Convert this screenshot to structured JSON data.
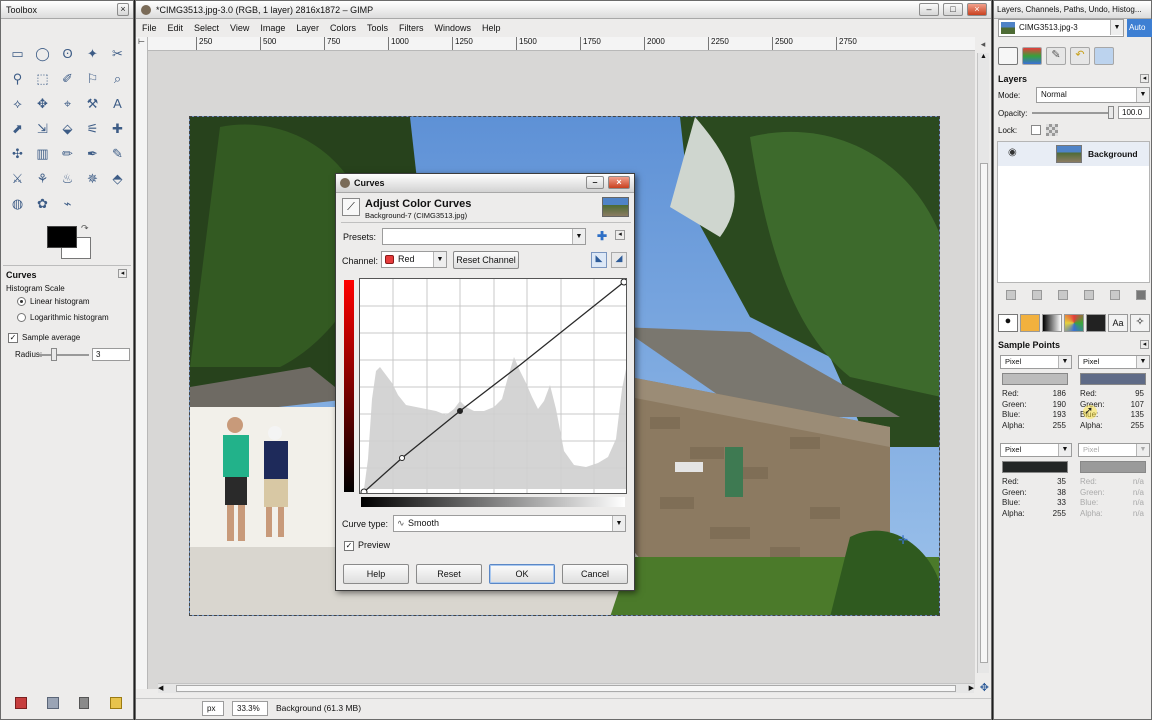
{
  "colors": {
    "accent_red": "#c80000",
    "desktop": "#1f1f1f",
    "panel": "#edeceb"
  },
  "toolbox": {
    "title": "Toolbox",
    "tool_options_title": "Curves",
    "histogram_scale_label": "Histogram Scale",
    "linear_label": "Linear histogram",
    "log_label": "Logarithmic histogram",
    "sample_average_label": "Sample average",
    "radius_label": "Radius:",
    "radius_value": "3"
  },
  "main": {
    "title": "*CIMG3513.jpg-3.0 (RGB, 1 layer) 2816x1872 – GIMP",
    "menu": [
      "File",
      "Edit",
      "Select",
      "View",
      "Image",
      "Layer",
      "Colors",
      "Tools",
      "Filters",
      "Windows",
      "Help"
    ],
    "ruler_ticks": [
      "250",
      "500",
      "750",
      "1000",
      "1250",
      "1500",
      "1750",
      "2000",
      "2250",
      "2500",
      "2750"
    ],
    "status_unit": "px",
    "status_zoom": "33.3%",
    "status_text": "Background (61.3 MB)"
  },
  "dialog": {
    "title": "Curves",
    "heading": "Adjust Color Curves",
    "subheading": "Background-7 (CIMG3513.jpg)",
    "presets_label": "Presets:",
    "presets_value": "",
    "channel_label": "Channel:",
    "channel_value": "Red",
    "reset_channel_label": "Reset Channel",
    "curve_type_label": "Curve type:",
    "curve_type_value": "Smooth",
    "preview_label": "Preview",
    "help_label": "Help",
    "reset_label": "Reset",
    "ok_label": "OK",
    "cancel_label": "Cancel"
  },
  "dock": {
    "title": "Layers, Channels, Paths, Undo, Histog...",
    "image_selector": "CIMG3513.jpg-3",
    "auto_label": "Auto",
    "layers_title": "Layers",
    "mode_label": "Mode:",
    "mode_value": "Normal",
    "opacity_label": "Opacity:",
    "opacity_value": "100.0",
    "lock_label": "Lock:",
    "layer_name": "Background",
    "sample_points_title": "Sample Points",
    "sample_points": [
      {
        "mode": "Pixel",
        "swatch": "#bcbcbc",
        "red": "186",
        "green": "190",
        "blue": "193",
        "alpha": "255",
        "active": true
      },
      {
        "mode": "Pixel",
        "swatch": "#5f6b87",
        "red": "95",
        "green": "107",
        "blue": "135",
        "alpha": "255",
        "active": true
      },
      {
        "mode": "Pixel",
        "swatch": "#232626",
        "red": "35",
        "green": "38",
        "blue": "33",
        "alpha": "255",
        "active": true
      },
      {
        "mode": "Pixel",
        "swatch": "#9a9a9a",
        "red": "n/a",
        "green": "n/a",
        "blue": "n/a",
        "alpha": "n/a",
        "active": false
      }
    ],
    "labels": {
      "red": "Red:",
      "green": "Green:",
      "blue": "Blue:",
      "alpha": "Alpha:"
    }
  }
}
